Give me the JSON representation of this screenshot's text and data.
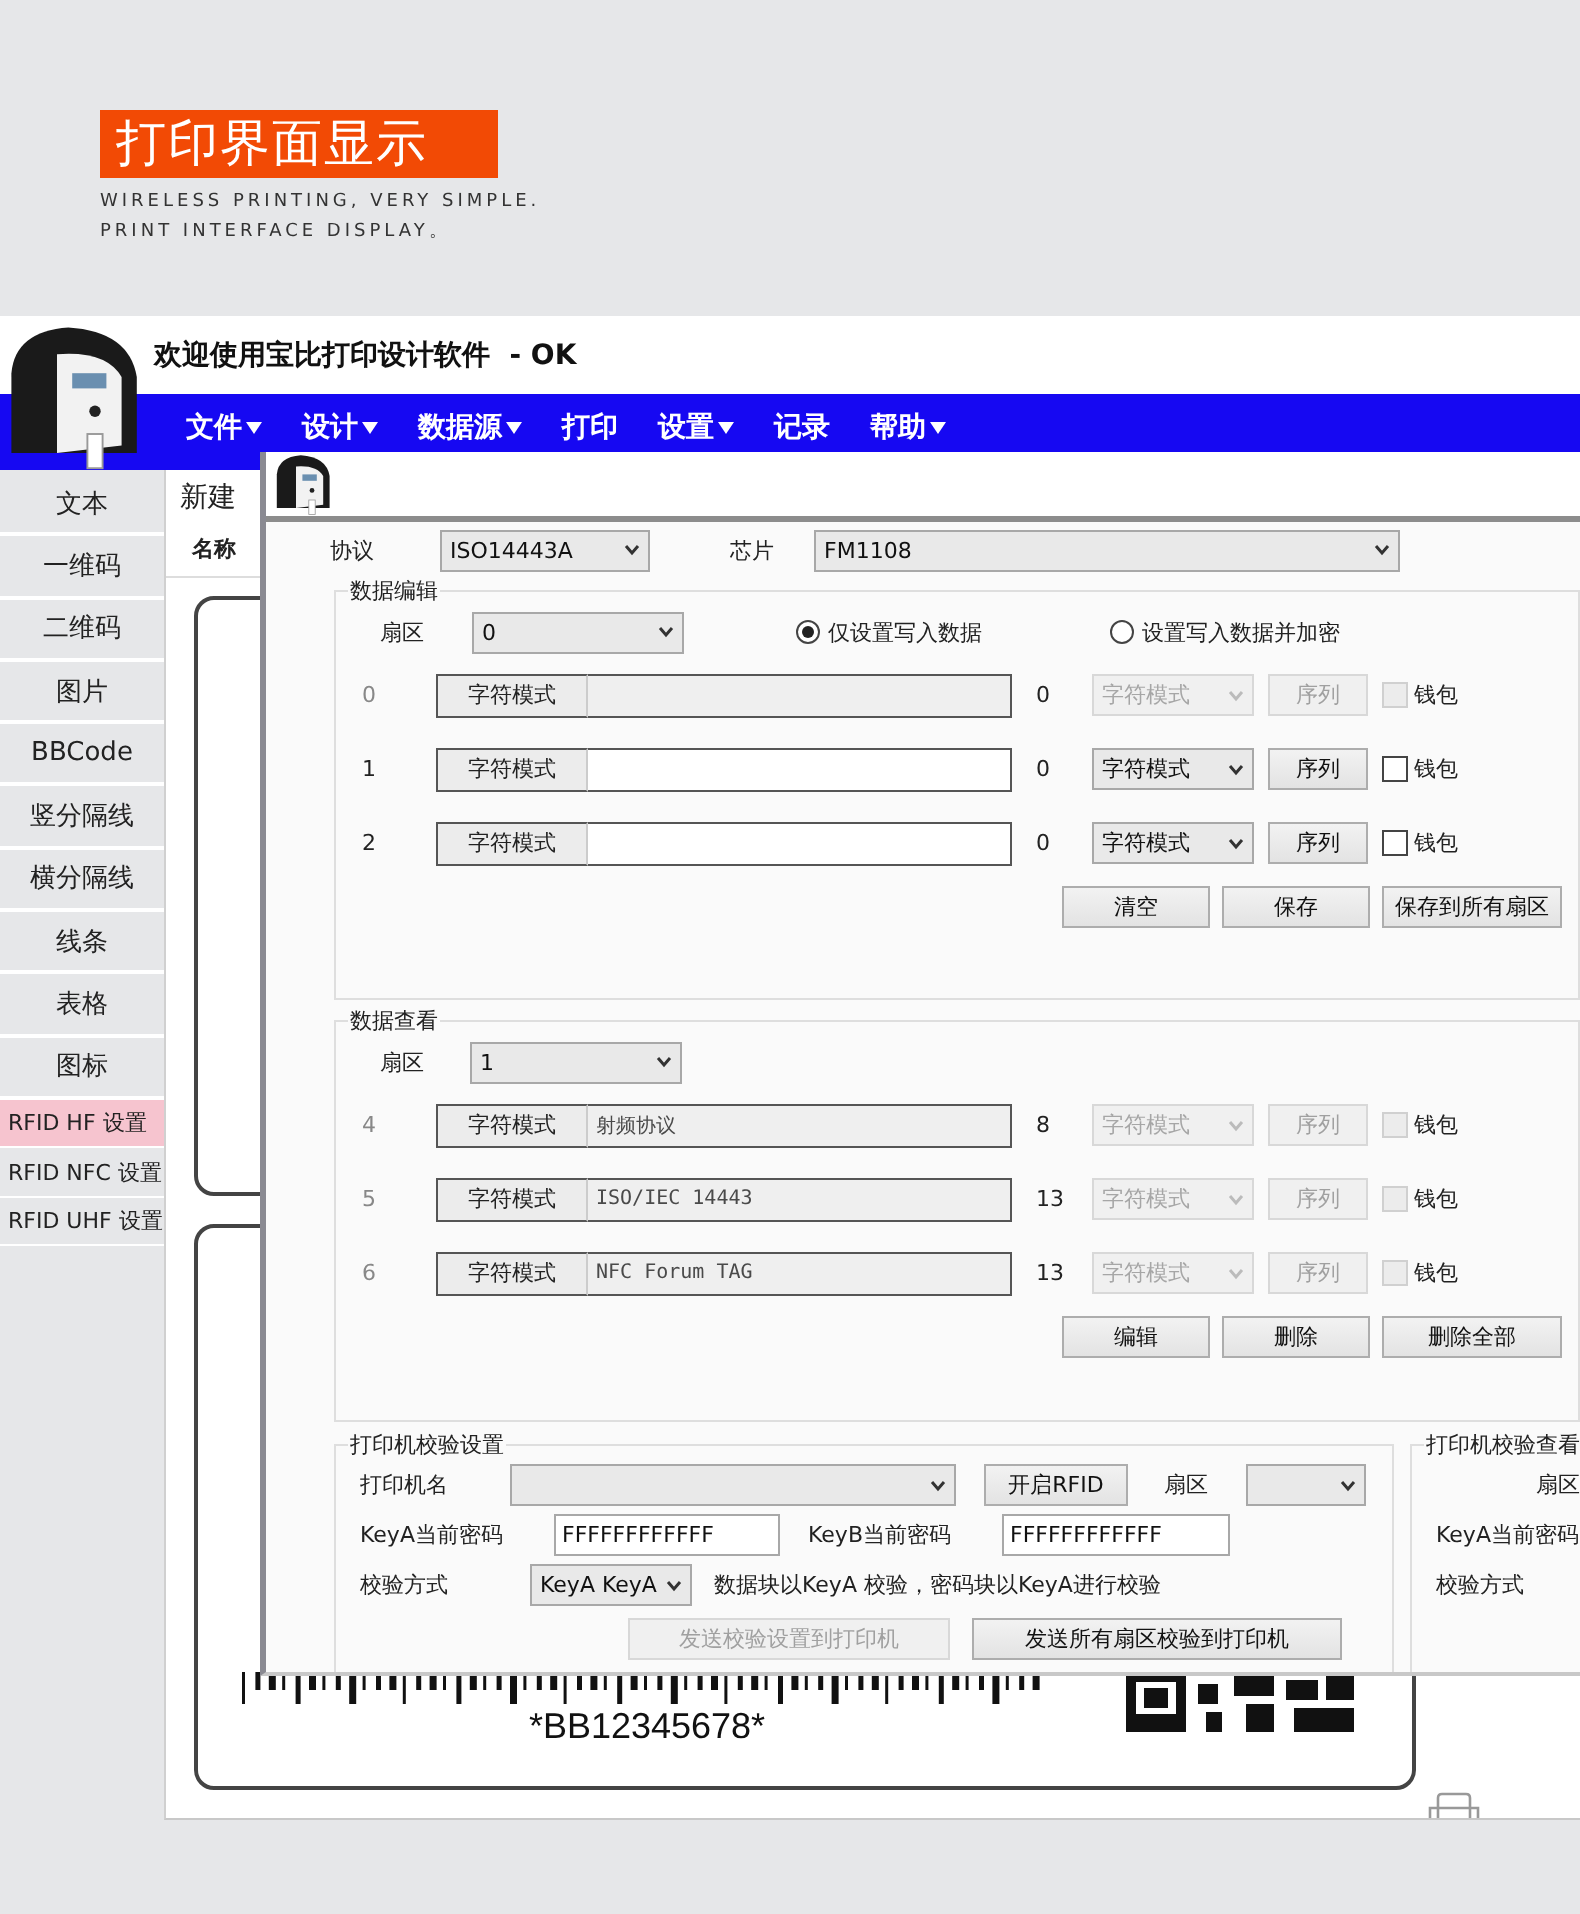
{
  "banner": {
    "title": "打印界面显示",
    "subtitle_lines": [
      "WIRELESS PRINTING, VERY SIMPLE.",
      "PRINT INTERFACE DISPLAY。"
    ]
  },
  "app": {
    "title": "欢迎使用宝比打印设计软件  - OK",
    "menu": [
      {
        "label": "文件",
        "dropdown": true
      },
      {
        "label": "设计",
        "dropdown": true
      },
      {
        "label": "数据源",
        "dropdown": true
      },
      {
        "label": "打印",
        "dropdown": false
      },
      {
        "label": "设置",
        "dropdown": true
      },
      {
        "label": "记录",
        "dropdown": false
      },
      {
        "label": "帮助",
        "dropdown": true
      }
    ],
    "sidebar": [
      {
        "label": "文本",
        "kind": "tool",
        "selected": false
      },
      {
        "label": "一维码",
        "kind": "tool",
        "selected": false
      },
      {
        "label": "二维码",
        "kind": "tool",
        "selected": false
      },
      {
        "label": "图片",
        "kind": "tool",
        "selected": false
      },
      {
        "label": "BBCode",
        "kind": "tool",
        "selected": false
      },
      {
        "label": "竖分隔线",
        "kind": "tool",
        "selected": false
      },
      {
        "label": "横分隔线",
        "kind": "tool",
        "selected": false
      },
      {
        "label": "线条",
        "kind": "tool",
        "selected": false
      },
      {
        "label": "表格",
        "kind": "tool",
        "selected": false
      },
      {
        "label": "图标",
        "kind": "tool",
        "selected": false
      },
      {
        "label": "RFID HF 设置",
        "kind": "setting",
        "selected": true
      },
      {
        "label": "RFID NFC 设置",
        "kind": "setting",
        "selected": false
      },
      {
        "label": "RFID UHF 设置",
        "kind": "setting",
        "selected": false
      }
    ],
    "document": {
      "tab": "新建",
      "name_label": "名称",
      "barcode_text": "*BB12345678*"
    }
  },
  "dialog": {
    "protocol": {
      "label": "协议",
      "value": "ISO14443A"
    },
    "chip": {
      "label": "芯片",
      "value": "FM1108"
    },
    "data_edit": {
      "title": "数据编辑",
      "sector": {
        "label": "扇区",
        "value": "0"
      },
      "modes": [
        {
          "label": "仅设置写入数据",
          "selected": true
        },
        {
          "label": "设置写入数据并加密",
          "selected": false
        }
      ],
      "rows": [
        {
          "index": "0",
          "mode": "字符模式",
          "count": "0",
          "format": "字符模式",
          "sequence": "序列",
          "wallet": "钱包",
          "checked": false,
          "disabled": true
        },
        {
          "index": "1",
          "mode": "字符模式",
          "count": "0",
          "format": "字符模式",
          "sequence": "序列",
          "wallet": "钱包",
          "checked": false,
          "disabled": false
        },
        {
          "index": "2",
          "mode": "字符模式",
          "count": "0",
          "format": "字符模式",
          "sequence": "序列",
          "wallet": "钱包",
          "checked": false,
          "disabled": false
        }
      ],
      "buttons": [
        {
          "label": "清空",
          "disabled": false
        },
        {
          "label": "保存",
          "disabled": false
        },
        {
          "label": "保存到所有扇区",
          "disabled": false
        }
      ]
    },
    "data_view": {
      "title": "数据查看",
      "sector": {
        "label": "扇区",
        "value": "1"
      },
      "rows": [
        {
          "index": "4",
          "mode": "字符模式",
          "value": "射频协议",
          "count": "8",
          "format": "字符模式",
          "sequence": "序列",
          "wallet": "钱包",
          "checked": false,
          "disabled": true
        },
        {
          "index": "5",
          "mode": "字符模式",
          "value": "ISO/IEC 14443",
          "count": "13",
          "format": "字符模式",
          "sequence": "序列",
          "wallet": "钱包",
          "checked": false,
          "disabled": true
        },
        {
          "index": "6",
          "mode": "字符模式",
          "value": "NFC Forum TAG",
          "count": "13",
          "format": "字符模式",
          "sequence": "序列",
          "wallet": "钱包",
          "checked": false,
          "disabled": true
        }
      ],
      "buttons": [
        {
          "label": "编辑",
          "disabled": false
        },
        {
          "label": "删除",
          "disabled": false
        },
        {
          "label": "删除全部",
          "disabled": false
        }
      ]
    },
    "verify": {
      "title": "打印机校验设置",
      "printer_label": "打印机名",
      "open_rfid": "开启RFID",
      "sector_label": "扇区",
      "keya_label": "KeyA当前密码",
      "keya_value": "FFFFFFFFFFFF",
      "keyb_label": "KeyB当前密码",
      "keyb_value": "FFFFFFFFFFFF",
      "method_label": "校验方式",
      "method_value": "KeyA KeyA",
      "method_note": "数据块以KeyA 校验，密码块以KeyA进行校验",
      "buttons": [
        {
          "label": "发送校验设置到打印机",
          "disabled": true
        },
        {
          "label": "发送所有扇区校验到打印机",
          "disabled": false
        }
      ]
    },
    "verify_view": {
      "title": "打印机校验查看",
      "labels": [
        "扇区",
        "KeyA当前密码",
        "校验方式"
      ]
    }
  }
}
